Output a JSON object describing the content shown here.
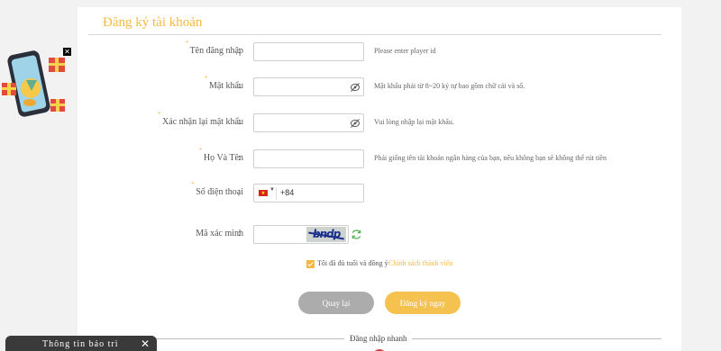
{
  "form": {
    "title": "Đăng ký tài khoản",
    "fields": [
      {
        "label": "Tên đăng nhập",
        "colon": ":",
        "value": "",
        "hint": "Please enter player id"
      },
      {
        "label": "Mật khẩu",
        "colon": ":",
        "value": "",
        "hint": "Mật khẩu phải từ 8~20 ký tự bao gồm chữ cái và số."
      },
      {
        "label": "Xác nhận lại mật khẩu",
        "colon": ":",
        "value": "",
        "hint": "Vui lòng nhập lại mật khẩu."
      },
      {
        "label": "Họ Và Tên",
        "colon": ":",
        "value": "",
        "hint": "Phải giống tên tài khoản ngân hàng của bạn, nếu không bạn sẽ không thể rút tiền"
      },
      {
        "label": "Số điện thoại",
        "colon": ":",
        "country_code": "+84"
      },
      {
        "label": "Mã xác minh",
        "colon": ":",
        "value": "",
        "captcha_text": "bndp"
      }
    ],
    "required_mark": "*",
    "agree_text": "Tôi đã đủ tuổi và đồng ý",
    "agree_link": "Chính sách thành viên",
    "agree_checked": true,
    "back_button": "Quay lại",
    "submit_button": "Đăng ký ngay",
    "quick_login": "Đăng nhập nhanh"
  },
  "promo": {
    "close_label": "✕"
  },
  "notice": {
    "title": "Thông tin bảo trì",
    "close_label": "✕"
  },
  "colors": {
    "accent": "#f5b942",
    "back_button": "#acacac",
    "submit_button": "#f5c14f",
    "notice_bg": "#3a3a3a"
  }
}
